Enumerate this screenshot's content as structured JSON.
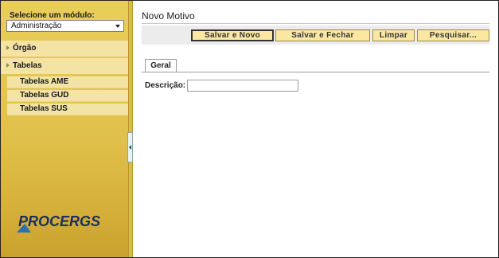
{
  "sidebar": {
    "module_label": "Selecione um módulo:",
    "module_select_value": "Administração",
    "menu": [
      {
        "label": "Órgão"
      },
      {
        "label": "Tabelas",
        "items": [
          {
            "label": "Tabelas AME"
          },
          {
            "label": "Tabelas GUD"
          },
          {
            "label": "Tabelas SUS"
          }
        ]
      }
    ],
    "logo_text": "PROCERGS"
  },
  "main": {
    "title": "Novo Motivo",
    "toolbar": {
      "save_new": "Salvar e Novo",
      "save_close": "Salvar e Fechar",
      "clear": "Limpar",
      "search": "Pesquisar..."
    },
    "tabs": [
      {
        "label": "Geral"
      }
    ],
    "form": {
      "description_label": "Descrição:",
      "description_value": ""
    }
  },
  "colors": {
    "sidebar_gold": "#e0c04a",
    "button_fill": "#fbe7a2",
    "logo_blue": "#1b2f5e"
  }
}
